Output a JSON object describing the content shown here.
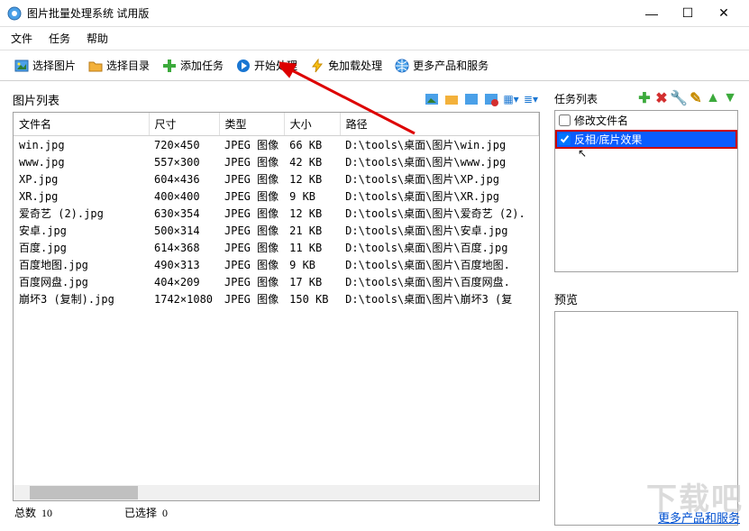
{
  "window": {
    "title": "图片批量处理系统 试用版"
  },
  "menu": {
    "file": "文件",
    "task": "任务",
    "help": "帮助"
  },
  "toolbar": {
    "select_images": "选择图片",
    "select_folder": "选择目录",
    "add_task": "添加任务",
    "start": "开始处理",
    "no_load": "免加载处理",
    "more": "更多产品和服务"
  },
  "left": {
    "title": "图片列表",
    "columns": {
      "name": "文件名",
      "dim": "尺寸",
      "type": "类型",
      "size": "大小",
      "path": "路径"
    },
    "rows": [
      {
        "name": "win.jpg",
        "dim": "720×450",
        "type": "JPEG 图像",
        "size": "66 KB",
        "path": "D:\\tools\\桌面\\图片\\win.jpg"
      },
      {
        "name": "www.jpg",
        "dim": "557×300",
        "type": "JPEG 图像",
        "size": "42 KB",
        "path": "D:\\tools\\桌面\\图片\\www.jpg"
      },
      {
        "name": "XP.jpg",
        "dim": "604×436",
        "type": "JPEG 图像",
        "size": "12 KB",
        "path": "D:\\tools\\桌面\\图片\\XP.jpg"
      },
      {
        "name": "XR.jpg",
        "dim": "400×400",
        "type": "JPEG 图像",
        "size": "9 KB",
        "path": "D:\\tools\\桌面\\图片\\XR.jpg"
      },
      {
        "name": "爱奇艺 (2).jpg",
        "dim": "630×354",
        "type": "JPEG 图像",
        "size": "12 KB",
        "path": "D:\\tools\\桌面\\图片\\爱奇艺 (2)."
      },
      {
        "name": "安卓.jpg",
        "dim": "500×314",
        "type": "JPEG 图像",
        "size": "21 KB",
        "path": "D:\\tools\\桌面\\图片\\安卓.jpg"
      },
      {
        "name": "百度.jpg",
        "dim": "614×368",
        "type": "JPEG 图像",
        "size": "11 KB",
        "path": "D:\\tools\\桌面\\图片\\百度.jpg"
      },
      {
        "name": "百度地图.jpg",
        "dim": "490×313",
        "type": "JPEG 图像",
        "size": "9 KB",
        "path": "D:\\tools\\桌面\\图片\\百度地图."
      },
      {
        "name": "百度网盘.jpg",
        "dim": "404×209",
        "type": "JPEG 图像",
        "size": "17 KB",
        "path": "D:\\tools\\桌面\\图片\\百度网盘."
      },
      {
        "name": "崩坏3 (复制).jpg",
        "dim": "1742×1080",
        "type": "JPEG 图像",
        "size": "150 KB",
        "path": "D:\\tools\\桌面\\图片\\崩坏3 (复"
      }
    ],
    "status_total_label": "总数",
    "status_total_val": "10",
    "status_sel_label": "已选择",
    "status_sel_val": "0"
  },
  "right": {
    "title": "任务列表",
    "task_rename": "修改文件名",
    "task_invert": "反相/底片效果",
    "preview_label": "预览"
  },
  "footer": {
    "link": "更多产品和服务"
  },
  "watermark": "下载吧"
}
